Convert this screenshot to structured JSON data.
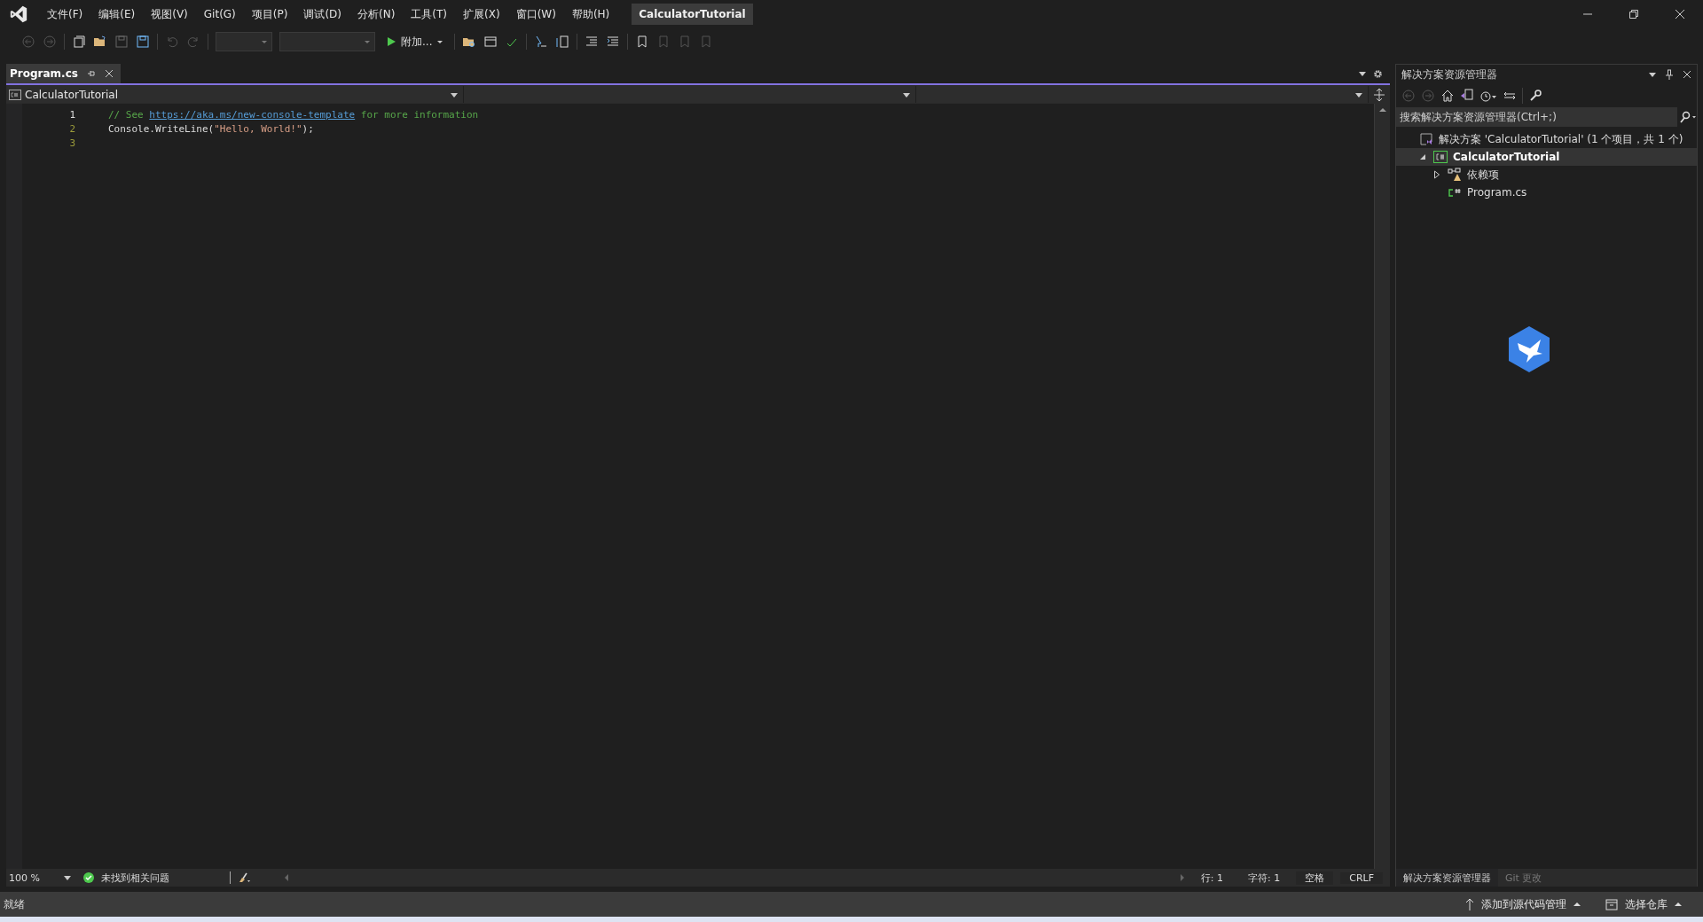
{
  "menu": [
    "文件(F)",
    "编辑(E)",
    "视图(V)",
    "Git(G)",
    "项目(P)",
    "调试(D)",
    "分析(N)",
    "工具(T)",
    "扩展(X)",
    "窗口(W)",
    "帮助(H)"
  ],
  "window": {
    "title": "CalculatorTutorial"
  },
  "toolbar": {
    "run_label": "附加..."
  },
  "editor": {
    "tabs": [
      {
        "label": "Program.cs",
        "selected": true
      }
    ],
    "nav": {
      "project": "CalculatorTutorial"
    },
    "lines": [
      {
        "number": "1",
        "current": true,
        "tokens": [
          {
            "kind": "comment",
            "text": "// See "
          },
          {
            "kind": "link",
            "text": "https://aka.ms/new-console-template"
          },
          {
            "kind": "comment",
            "text": " for more information"
          }
        ]
      },
      {
        "number": "2",
        "current": false,
        "tokens": [
          {
            "kind": "plain",
            "text": "Console.WriteLine("
          },
          {
            "kind": "string",
            "text": "\"Hello, World!\""
          },
          {
            "kind": "plain",
            "text": ");"
          }
        ]
      },
      {
        "number": "3",
        "current": false
      }
    ],
    "status": {
      "zoom": "100 %",
      "issues": "未找到相关问题",
      "line": "行: 1",
      "char": "字符: 1",
      "spaces": "空格",
      "eol": "CRLF"
    }
  },
  "solution_explorer": {
    "title": "解决方案资源管理器",
    "search": {
      "placeholder": "搜索解决方案资源管理器(Ctrl+;)"
    },
    "tree": [
      {
        "label": "解决方案 'CalculatorTutorial' (1 个项目，共 1 个)",
        "kind": "solution",
        "selected": false,
        "children": [
          {
            "label": "CalculatorTutorial",
            "kind": "project",
            "selected": true,
            "expanded": true,
            "children": [
              {
                "label": "依赖项",
                "kind": "deps",
                "selected": false,
                "expanded": false
              },
              {
                "label": "Program.cs",
                "kind": "file",
                "selected": false
              }
            ]
          }
        ]
      }
    ]
  },
  "panel_tabs": [
    {
      "label": "解决方案资源管理器",
      "selected": true
    },
    {
      "label": "Git 更改",
      "selected": false
    }
  ],
  "status_bar": {
    "text": "就绪",
    "source_control": "添加到源代码管理",
    "repository": "选择仓库"
  }
}
